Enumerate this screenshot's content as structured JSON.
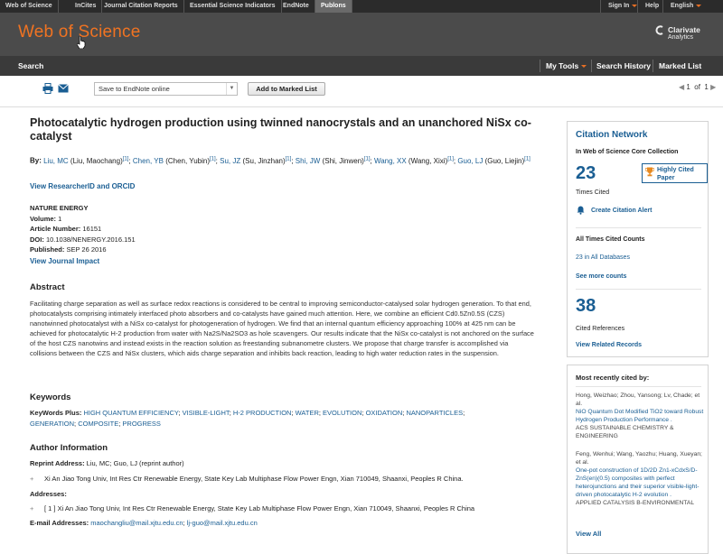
{
  "topbar": {
    "left_links": [
      "Web of Science",
      "InCites",
      "Journal Citation Reports",
      "Essential Science Indicators",
      "EndNote",
      "Publons"
    ],
    "signin": "Sign In",
    "help": "Help",
    "language": "English"
  },
  "header": {
    "logo": "Web of Science",
    "brand_line1": "Clarivate",
    "brand_line2": "Analytics"
  },
  "nav": {
    "search": "Search",
    "my_tools": "My Tools",
    "search_history": "Search History",
    "marked_list": "Marked List"
  },
  "toolbar": {
    "save_select": "Save to EndNote online",
    "add_button": "Add to Marked List",
    "page_current": "1",
    "page_of": "of",
    "page_total": "1"
  },
  "record": {
    "title": "Photocatalytic hydrogen production using twinned nanocrystals and an unanchored NiSx co-catalyst",
    "by_label": "By:",
    "authors": [
      {
        "short": "Liu, MC",
        "full": "(Liu, Maochang)",
        "sup": "[1]",
        "link": false
      },
      {
        "short": "Chen, YB",
        "full": "(Chen, Yubin)",
        "sup": "[1]",
        "link": true
      },
      {
        "short": "Su, JZ",
        "full": "(Su, Jinzhan)",
        "sup": "[1]",
        "link": true
      },
      {
        "short": "Shi, JW",
        "full": "(Shi, Jinwen)",
        "sup": "[1]",
        "link": true
      },
      {
        "short": "Wang, XX",
        "full": "(Wang, Xixi)",
        "sup": "[1]",
        "link": true
      },
      {
        "short": "Guo, LJ",
        "full": "(Guo, Liejin)",
        "sup": "[1]",
        "link": true
      }
    ],
    "view_researcherid": "View ResearcherID and ORCID",
    "journal": "NATURE ENERGY",
    "volume_label": "Volume:",
    "volume": "1",
    "article_label": "Article Number:",
    "article_number": "16151",
    "doi_label": "DOI:",
    "doi": "10.1038/NENERGY.2016.151",
    "published_label": "Published:",
    "published": "SEP 26 2016",
    "view_journal_impact": "View Journal Impact",
    "abstract_heading": "Abstract",
    "abstract": "Facilitating charge separation as well as surface redox reactions is considered to be central to improving semiconductor-catalysed solar hydrogen generation. To that end, photocatalysts comprising intimately interfaced photo absorbers and co-catalysts have gained much attention. Here, we combine an efficient Cd0.5Zn0.5S (CZS) nanotwinned photocatalyst with a NiSx co-catalyst for photogeneration of hydrogen. We find that an internal quantum efficiency approaching 100% at 425 nm can be achieved for photocatalytic H-2 production from water with Na2S/Na2SO3 as hole scavengers. Our results indicate that the NiSx co-catalyst is not anchored on the surface of the host CZS nanotwins and instead exists in the reaction solution as freestanding subnanometre clusters. We propose that charge transfer is accomplished via collisions between the CZS and NiSx clusters, which aids charge separation and inhibits back reaction, leading to high water reduction rates in the suspension.",
    "keywords_heading": "Keywords",
    "keywords_label": "KeyWords Plus:",
    "keywords": [
      "HIGH QUANTUM EFFICIENCY",
      "VISIBLE-LIGHT",
      "H-2 PRODUCTION",
      "WATER",
      "EVOLUTION",
      "OXIDATION",
      "NANOPARTICLES",
      "GENERATION",
      "COMPOSITE",
      "PROGRESS"
    ],
    "author_info_heading": "Author Information",
    "reprint_label": "Reprint Address:",
    "reprint_value": "Liu, MC; Guo, LJ (reprint author)",
    "reprint_address": "Xi An Jiao Tong Univ, Int Res Ctr Renewable Energy, State Key Lab Multiphase Flow Power Engn, Xian 710049, Shaanxi, Peoples R China.",
    "addresses_label": "Addresses:",
    "address_line": "[ 1 ] Xi An Jiao Tong Univ, Int Res Ctr Renewable Energy, State Key Lab Multiphase Flow Power Engn, Xian 710049, Shaanxi, Peoples R China",
    "email_label": "E-mail Addresses:",
    "email1": "maochangliu@mail.xjtu.edu.cn",
    "email2": "lj-guo@mail.xjtu.edu.cn"
  },
  "citation": {
    "heading": "Citation Network",
    "sub": "In Web of Science Core Collection",
    "times_cited": "23",
    "times_cited_label": "Times Cited",
    "highly_cited": "Highly Cited Paper",
    "create_alert": "Create Citation Alert",
    "all_times_heading": "All Times Cited Counts",
    "all_db_count": "23",
    "all_db_label": "in All Databases",
    "see_more": "See more counts",
    "cited_refs": "38",
    "cited_refs_label": "Cited References",
    "view_related": "View Related Records"
  },
  "recent": {
    "heading": "Most recently cited by:",
    "items": [
      {
        "authors": "Hong, Weizhao; Zhou, Yansong; Lv, Chade; et al.",
        "title": "NiO Quantum Dot Modified TiO2 toward Robust Hydrogen Production Performance .",
        "source": "ACS SUSTAINABLE CHEMISTRY & ENGINEERING"
      },
      {
        "authors": "Feng, Wenhui; Wang, Yaozhu; Huang, Xueyan; et al.",
        "title": "One-pot construction of 1D/2D Zn1-xCdxS/D-ZnS(en)(0.5) composites with perfect heterojunctions and their superior visible-light-driven photocatalytic H-2 evolution .",
        "source": "APPLIED CATALYSIS B-ENVIRONMENTAL"
      }
    ],
    "view_all": "View All"
  },
  "colors": {
    "accent": "#f07322",
    "link": "#1a5e93",
    "header": "#4b4b4b"
  }
}
